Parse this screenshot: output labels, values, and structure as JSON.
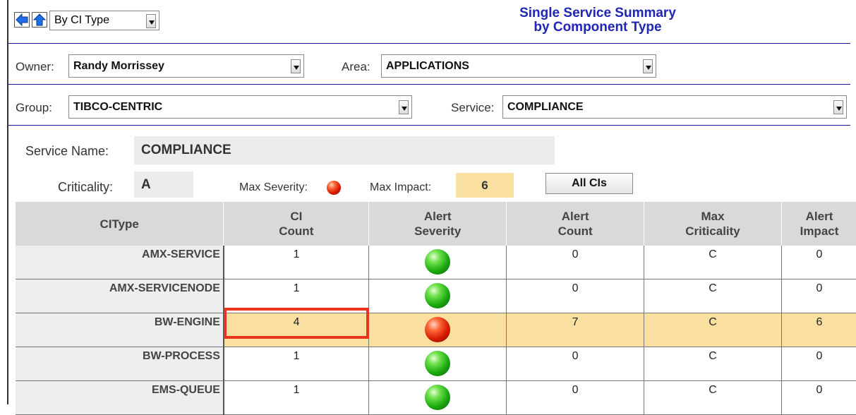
{
  "toolbar": {
    "view_select": "By CI Type",
    "title_line1": "Single Service Summary",
    "title_line2": "by Component Type"
  },
  "filters": {
    "owner_label": "Owner:",
    "owner_value": "Randy Morrissey",
    "area_label": "Area:",
    "area_value": "APPLICATIONS",
    "group_label": "Group:",
    "group_value": "TIBCO-CENTRIC",
    "service_label": "Service:",
    "service_value": "COMPLIANCE"
  },
  "summary": {
    "service_name_label": "Service Name:",
    "service_name_value": "COMPLIANCE",
    "criticality_label": "Criticality:",
    "criticality_value": "A",
    "max_severity_label": "Max Severity:",
    "max_severity_icon": "red-status-icon",
    "max_impact_label": "Max Impact:",
    "max_impact_value": "6",
    "all_cis_button": "All CIs"
  },
  "table": {
    "headers": [
      {
        "line1": "CIType",
        "line2": ""
      },
      {
        "line1": "CI",
        "line2": "Count"
      },
      {
        "line1": "Alert",
        "line2": "Severity"
      },
      {
        "line1": "Alert",
        "line2": "Count"
      },
      {
        "line1": "Max",
        "line2": "Criticality"
      },
      {
        "line1": "Alert",
        "line2": "Impact"
      }
    ],
    "rows": [
      {
        "ci_type": "AMX-SERVICE",
        "ci_count": "1",
        "severity": "green",
        "alert_count": "0",
        "max_criticality": "C",
        "alert_impact": "0"
      },
      {
        "ci_type": "AMX-SERVICENODE",
        "ci_count": "1",
        "severity": "green",
        "alert_count": "0",
        "max_criticality": "C",
        "alert_impact": "0"
      },
      {
        "ci_type": "BW-ENGINE",
        "ci_count": "4",
        "severity": "red",
        "alert_count": "7",
        "max_criticality": "C",
        "alert_impact": "6"
      },
      {
        "ci_type": "BW-PROCESS",
        "ci_count": "1",
        "severity": "green",
        "alert_count": "0",
        "max_criticality": "C",
        "alert_impact": "0"
      },
      {
        "ci_type": "EMS-QUEUE",
        "ci_count": "1",
        "severity": "green",
        "alert_count": "0",
        "max_criticality": "C",
        "alert_impact": "0"
      }
    ]
  },
  "colors": {
    "title": "#1f25b5",
    "highlight_row": "#fae0a0",
    "selection_box": "#e8331d",
    "header_bg": "#d9d9d9"
  }
}
